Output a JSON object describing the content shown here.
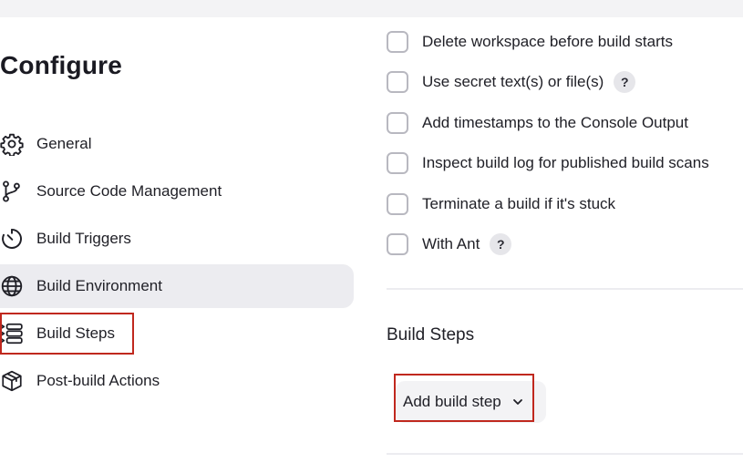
{
  "page": {
    "title": "Configure"
  },
  "sidebar": {
    "items": [
      {
        "label": "General",
        "icon": "gear-icon",
        "active": false
      },
      {
        "label": "Source Code Management",
        "icon": "branch-icon",
        "active": false
      },
      {
        "label": "Build Triggers",
        "icon": "timer-icon",
        "active": false
      },
      {
        "label": "Build Environment",
        "icon": "globe-icon",
        "active": true
      },
      {
        "label": "Build Steps",
        "icon": "list-icon",
        "active": false
      },
      {
        "label": "Post-build Actions",
        "icon": "package-icon",
        "active": false
      }
    ]
  },
  "build_environment": {
    "options": [
      {
        "label": "Delete workspace before build starts",
        "checked": false,
        "help": false
      },
      {
        "label": "Use secret text(s) or file(s)",
        "checked": false,
        "help": true
      },
      {
        "label": "Add timestamps to the Console Output",
        "checked": false,
        "help": false
      },
      {
        "label": "Inspect build log for published build scans",
        "checked": false,
        "help": false
      },
      {
        "label": "Terminate a build if it's stuck",
        "checked": false,
        "help": false
      },
      {
        "label": "With Ant",
        "checked": false,
        "help": true
      }
    ],
    "help_symbol": "?"
  },
  "build_steps": {
    "title": "Build Steps",
    "add_button_label": "Add build step"
  },
  "colors": {
    "highlight": "#c0281e",
    "active_nav_bg": "#ececf0"
  }
}
